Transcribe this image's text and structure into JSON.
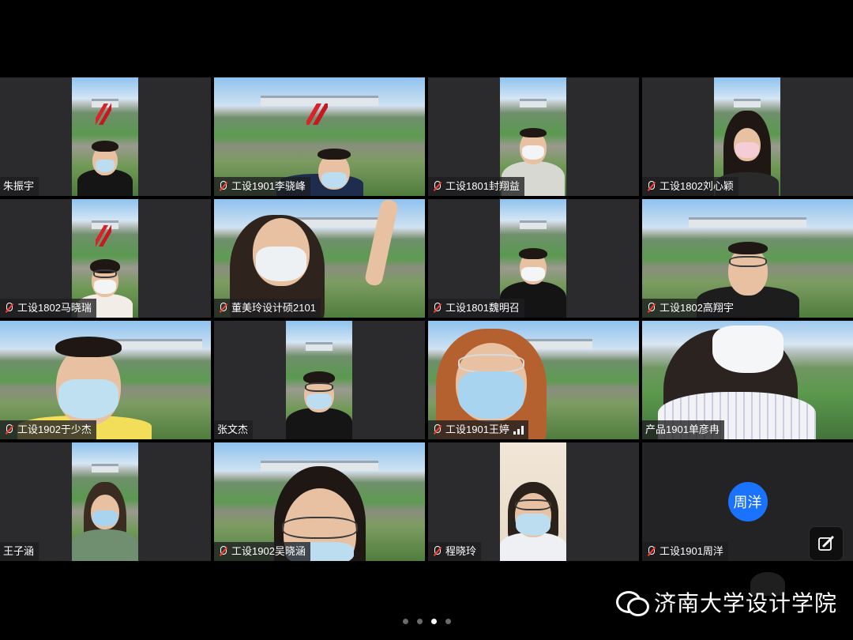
{
  "participants": [
    {
      "name": "朱振宇",
      "muted": false
    },
    {
      "name": "工设1901李骁峰",
      "muted": true
    },
    {
      "name": "工设1801封翔益",
      "muted": true
    },
    {
      "name": "工设1802刘心颖",
      "muted": true
    },
    {
      "name": "工设1802马晓瑞",
      "muted": true
    },
    {
      "name": "董美玲设计硕2101",
      "muted": true
    },
    {
      "name": "工设1801魏明召",
      "muted": true
    },
    {
      "name": "工设1802高翔宇",
      "muted": true
    },
    {
      "name": "工设1902于少杰",
      "muted": true
    },
    {
      "name": "张文杰",
      "muted": false
    },
    {
      "name": "工设1901王婷",
      "muted": true,
      "signal_bars": 3
    },
    {
      "name": "产品1901单彦冉",
      "muted": false
    },
    {
      "name": "王子涵",
      "muted": false
    },
    {
      "name": "工设1902吴晓涵",
      "muted": true
    },
    {
      "name": "程晓玲",
      "muted": true
    },
    {
      "name": "工设1901周洋",
      "muted": true,
      "video_off": true,
      "avatar_text": "周洋"
    }
  ],
  "watermark": {
    "text": "济南大学设计学院",
    "icon": "wechat-icon"
  },
  "pager": {
    "page_count": 4,
    "active_index": 2
  },
  "colors": {
    "avatar": "#1a73ff",
    "tile_bg": "#2b2b2d",
    "muted_icon": "#ff3b30"
  }
}
